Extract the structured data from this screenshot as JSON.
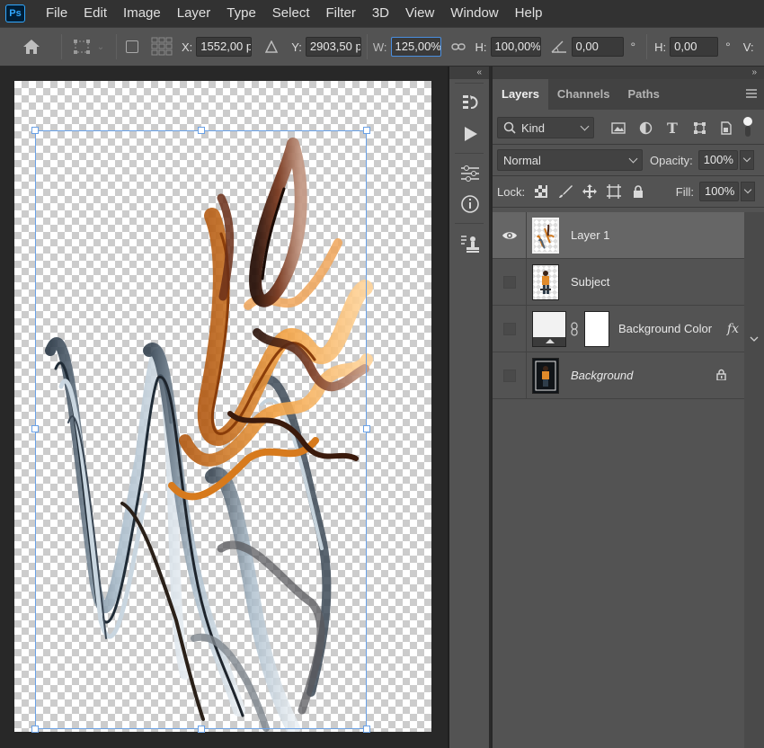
{
  "app": {
    "logo": "Ps"
  },
  "menu": [
    "File",
    "Edit",
    "Image",
    "Layer",
    "Type",
    "Select",
    "Filter",
    "3D",
    "View",
    "Window",
    "Help"
  ],
  "options": {
    "x_label": "X:",
    "x_value": "1552,00 p",
    "y_label": "Y:",
    "y_value": "2903,50 p",
    "w_label": "W:",
    "w_value": "125,00%",
    "h_label": "H:",
    "h_value": "100,00%",
    "angle_value": "0,00",
    "angle_unit": "°",
    "hskew_label": "H:",
    "hskew_value": "0,00",
    "hskew_unit": "°",
    "vskew_label": "V:"
  },
  "panel": {
    "tabs": [
      "Layers",
      "Channels",
      "Paths"
    ],
    "active_tab": "Layers",
    "filter_label": "Kind",
    "blend_mode": "Normal",
    "opacity_label": "Opacity:",
    "opacity_value": "100%",
    "lock_label": "Lock:",
    "fill_label": "Fill:",
    "fill_value": "100%"
  },
  "layers": [
    {
      "name": "Layer 1",
      "visible": true,
      "selected": true
    },
    {
      "name": "Subject",
      "visible": false,
      "selected": false
    },
    {
      "name": "Background Color",
      "visible": false,
      "selected": false,
      "fx": "fx"
    },
    {
      "name": "Background",
      "visible": false,
      "selected": false,
      "locked": true
    }
  ],
  "colors": {
    "accent": "#4a8fe0",
    "orange": "#e08a2a",
    "brown": "#4a2416",
    "steel": "#5d6f7e"
  }
}
